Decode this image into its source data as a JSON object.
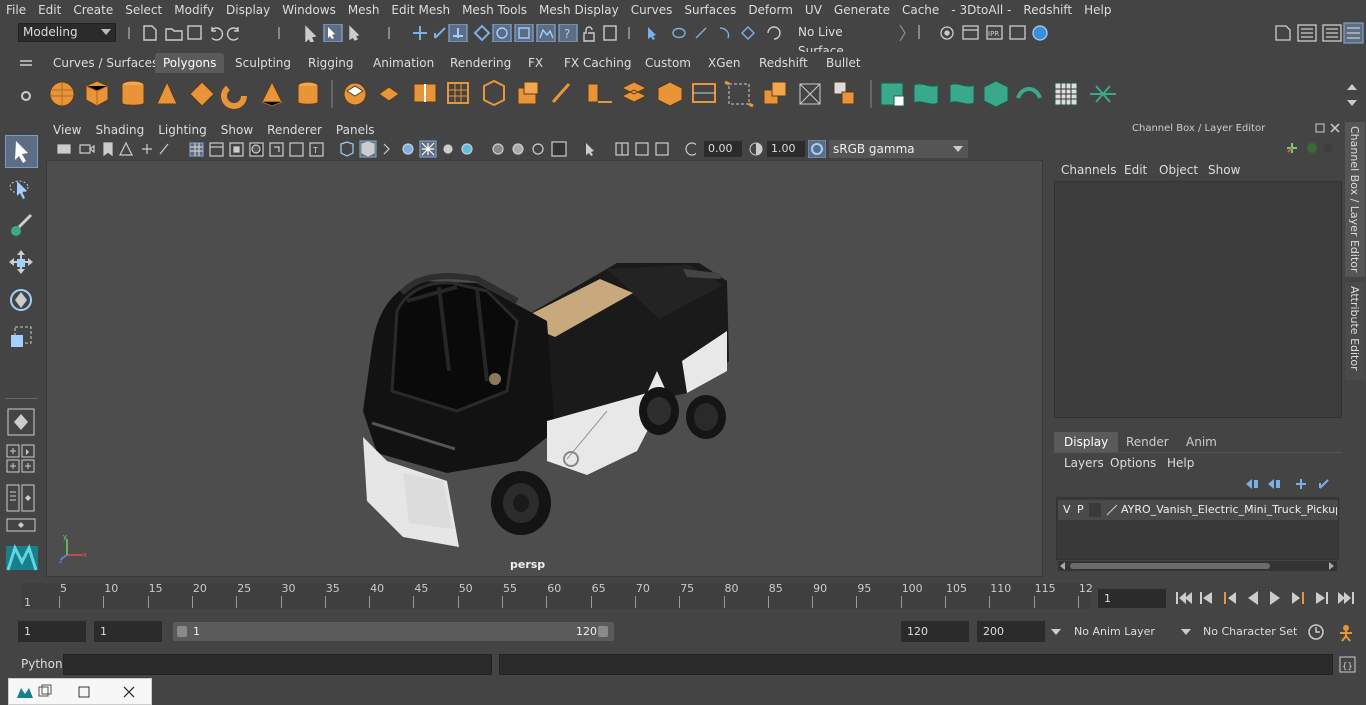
{
  "menubar": {
    "items": [
      "File",
      "Edit",
      "Create",
      "Select",
      "Modify",
      "Display",
      "Windows",
      "Mesh",
      "Edit Mesh",
      "Mesh Tools",
      "Mesh Display",
      "Curves",
      "Surfaces",
      "Deform",
      "UV",
      "Generate",
      "Cache",
      "- 3DtoAll -",
      "Redshift",
      "Help"
    ]
  },
  "statusline": {
    "mode": "Modeling",
    "live_surface": "No Live Surface"
  },
  "shelf": {
    "tabs": [
      "Curves / Surfaces",
      "Polygons",
      "Sculpting",
      "Rigging",
      "Animation",
      "Rendering",
      "FX",
      "FX Caching",
      "Custom",
      "XGen",
      "Redshift",
      "Bullet"
    ],
    "active_tab": "Polygons"
  },
  "viewport": {
    "menu": [
      "View",
      "Shading",
      "Lighting",
      "Show",
      "Renderer",
      "Panels"
    ],
    "exposure": "0.00",
    "gamma": "1.00",
    "color_space": "sRGB gamma",
    "camera_label": "persp"
  },
  "channel_box": {
    "title": "Channel Box / Layer Editor",
    "menu": [
      "Channels",
      "Edit",
      "Object",
      "Show"
    ]
  },
  "layer_editor": {
    "tabs": [
      "Display",
      "Render",
      "Anim"
    ],
    "active_tab": "Display",
    "menu": [
      "Layers",
      "Options",
      "Help"
    ],
    "layer": {
      "v": "V",
      "p": "P",
      "name": "AYRO_Vanish_Electric_Mini_Truck_Pickup_E"
    }
  },
  "side_tabs": {
    "channel_box": "Channel Box / Layer Editor",
    "attribute_editor": "Attribute Editor"
  },
  "timeline": {
    "ticks": [
      "5",
      "10",
      "15",
      "20",
      "25",
      "30",
      "35",
      "40",
      "45",
      "50",
      "55",
      "60",
      "65",
      "70",
      "75",
      "80",
      "85",
      "90",
      "95",
      "100",
      "105",
      "110",
      "115",
      "12"
    ],
    "start_marker": "1",
    "current_frame": "1"
  },
  "range": {
    "start": "1",
    "playback_start": "1",
    "slider_start": "1",
    "slider_end": "120",
    "playback_end": "120",
    "end": "200",
    "anim_layer": "No Anim Layer",
    "character_set": "No Character Set"
  },
  "command_line": {
    "label": "Python"
  },
  "colors": {
    "accent": "#5d6e84",
    "shelf_orange": "#e8953a",
    "shelf_teal": "#3aa88a"
  }
}
